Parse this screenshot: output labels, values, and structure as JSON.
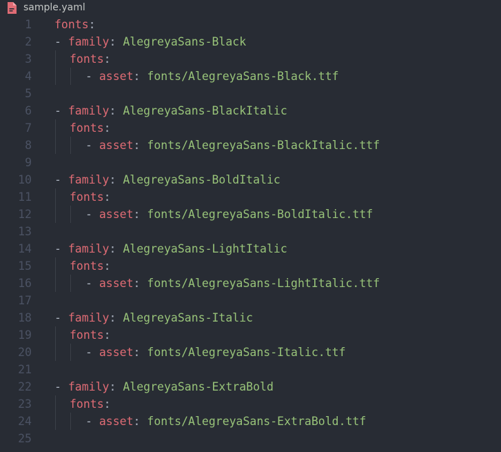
{
  "tab": {
    "file_name": "sample.yaml",
    "icon": "yaml-file-icon",
    "icon_color": "#e06c75"
  },
  "colors": {
    "background": "#282c34",
    "key": "#e06c75",
    "value": "#98c379",
    "punctuation": "#abb2bf",
    "line_number": "#4b5263"
  },
  "code": {
    "lines": [
      {
        "n": "1",
        "dash": "",
        "key": "fonts",
        "colon": ":",
        "value": ""
      },
      {
        "n": "2",
        "dash": "- ",
        "key": "family",
        "colon": ": ",
        "value": "AlegreyaSans-Black"
      },
      {
        "n": "3",
        "dash": "",
        "key": "fonts",
        "colon": ":",
        "value": ""
      },
      {
        "n": "4",
        "dash": "- ",
        "key": "asset",
        "colon": ": ",
        "value": "fonts/AlegreyaSans-Black.ttf"
      },
      {
        "n": "5",
        "dash": "",
        "key": "",
        "colon": "",
        "value": ""
      },
      {
        "n": "6",
        "dash": "- ",
        "key": "family",
        "colon": ": ",
        "value": "AlegreyaSans-BlackItalic"
      },
      {
        "n": "7",
        "dash": "",
        "key": "fonts",
        "colon": ":",
        "value": ""
      },
      {
        "n": "8",
        "dash": "- ",
        "key": "asset",
        "colon": ": ",
        "value": "fonts/AlegreyaSans-BlackItalic.ttf"
      },
      {
        "n": "9",
        "dash": "",
        "key": "",
        "colon": "",
        "value": ""
      },
      {
        "n": "10",
        "dash": "- ",
        "key": "family",
        "colon": ": ",
        "value": "AlegreyaSans-BoldItalic"
      },
      {
        "n": "11",
        "dash": "",
        "key": "fonts",
        "colon": ":",
        "value": ""
      },
      {
        "n": "12",
        "dash": "- ",
        "key": "asset",
        "colon": ": ",
        "value": "fonts/AlegreyaSans-BoldItalic.ttf"
      },
      {
        "n": "13",
        "dash": "",
        "key": "",
        "colon": "",
        "value": ""
      },
      {
        "n": "14",
        "dash": "- ",
        "key": "family",
        "colon": ": ",
        "value": "AlegreyaSans-LightItalic"
      },
      {
        "n": "15",
        "dash": "",
        "key": "fonts",
        "colon": ":",
        "value": ""
      },
      {
        "n": "16",
        "dash": "- ",
        "key": "asset",
        "colon": ": ",
        "value": "fonts/AlegreyaSans-LightItalic.ttf"
      },
      {
        "n": "17",
        "dash": "",
        "key": "",
        "colon": "",
        "value": ""
      },
      {
        "n": "18",
        "dash": "- ",
        "key": "family",
        "colon": ": ",
        "value": "AlegreyaSans-Italic"
      },
      {
        "n": "19",
        "dash": "",
        "key": "fonts",
        "colon": ":",
        "value": ""
      },
      {
        "n": "20",
        "dash": "- ",
        "key": "asset",
        "colon": ": ",
        "value": "fonts/AlegreyaSans-Italic.ttf"
      },
      {
        "n": "21",
        "dash": "",
        "key": "",
        "colon": "",
        "value": ""
      },
      {
        "n": "22",
        "dash": "- ",
        "key": "family",
        "colon": ": ",
        "value": "AlegreyaSans-ExtraBold"
      },
      {
        "n": "23",
        "dash": "",
        "key": "fonts",
        "colon": ":",
        "value": ""
      },
      {
        "n": "24",
        "dash": "- ",
        "key": "asset",
        "colon": ": ",
        "value": "fonts/AlegreyaSans-ExtraBold.ttf"
      },
      {
        "n": "25",
        "dash": "",
        "key": "",
        "colon": "",
        "value": ""
      }
    ]
  }
}
